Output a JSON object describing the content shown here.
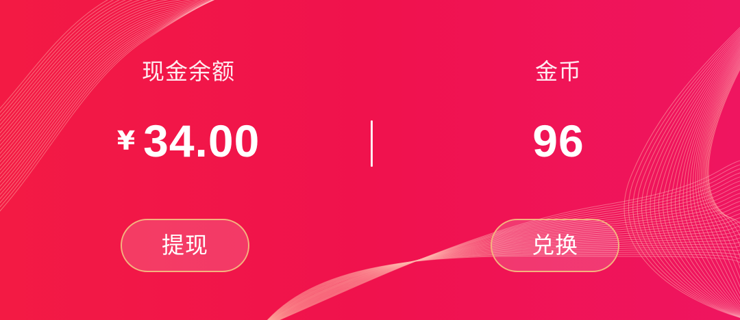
{
  "cash": {
    "label": "现金余额",
    "currency_symbol": "¥",
    "amount": "34.00",
    "action_label": "提现"
  },
  "coins": {
    "label": "金币",
    "amount": "96",
    "action_label": "兑换"
  },
  "colors": {
    "background_left": "#f31a44",
    "background_right": "#ef1560",
    "button_border": "#f4b47f",
    "text": "#ffffff"
  },
  "icons": {
    "currency": "yen-symbol",
    "background": "line-wave-pattern"
  }
}
